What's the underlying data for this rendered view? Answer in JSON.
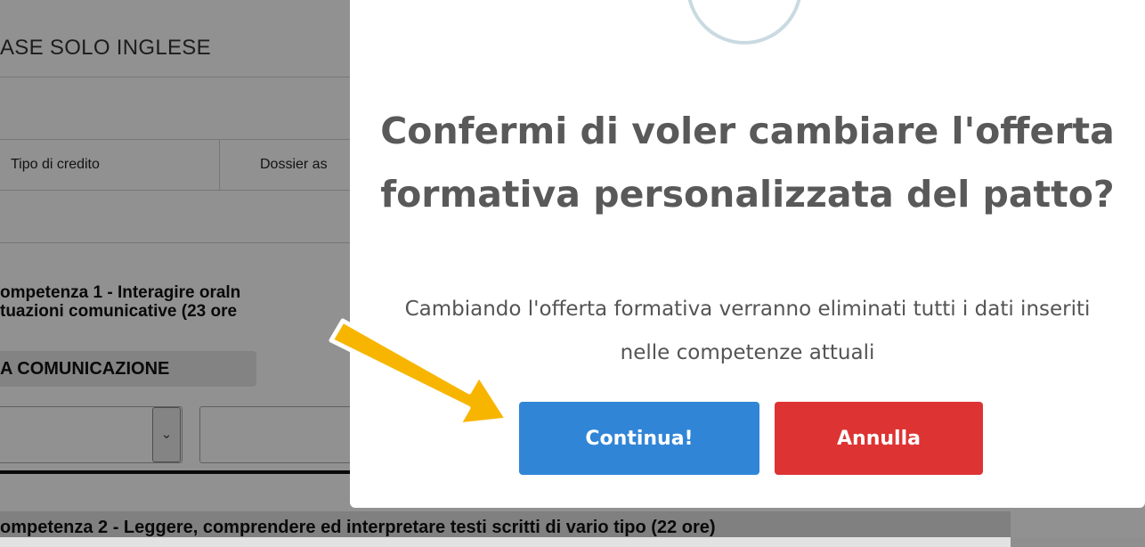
{
  "background": {
    "header_text": "ASE SOLO INGLESE",
    "table_head": {
      "col1": "Tipo di credito",
      "col2": "Dossier as"
    },
    "competence1": {
      "line1": "ompetenza 1 - Interagire oraln",
      "line2": "tuazioni comunicative (23 ore"
    },
    "badge": "A COMUNICAZIONE",
    "competence2": "ompetenza 2 - Leggere, comprendere ed interpretare testi scritti di vario tipo (22 ore)"
  },
  "dialog": {
    "title": "Confermi di voler cambiare l'offerta formativa personalizzata del patto?",
    "text": "Cambiando l'offerta formativa verranno eliminati tutti i dati inseriti nelle competenze attuali",
    "confirm_label": "Continua!",
    "cancel_label": "Annulla",
    "colors": {
      "confirm": "#3085d6",
      "cancel": "#dd3333",
      "icon_ring": "#c9dae1"
    }
  },
  "annotation": {
    "arrow_color": "#f7b500",
    "arrow_outline": "#ffffff"
  }
}
